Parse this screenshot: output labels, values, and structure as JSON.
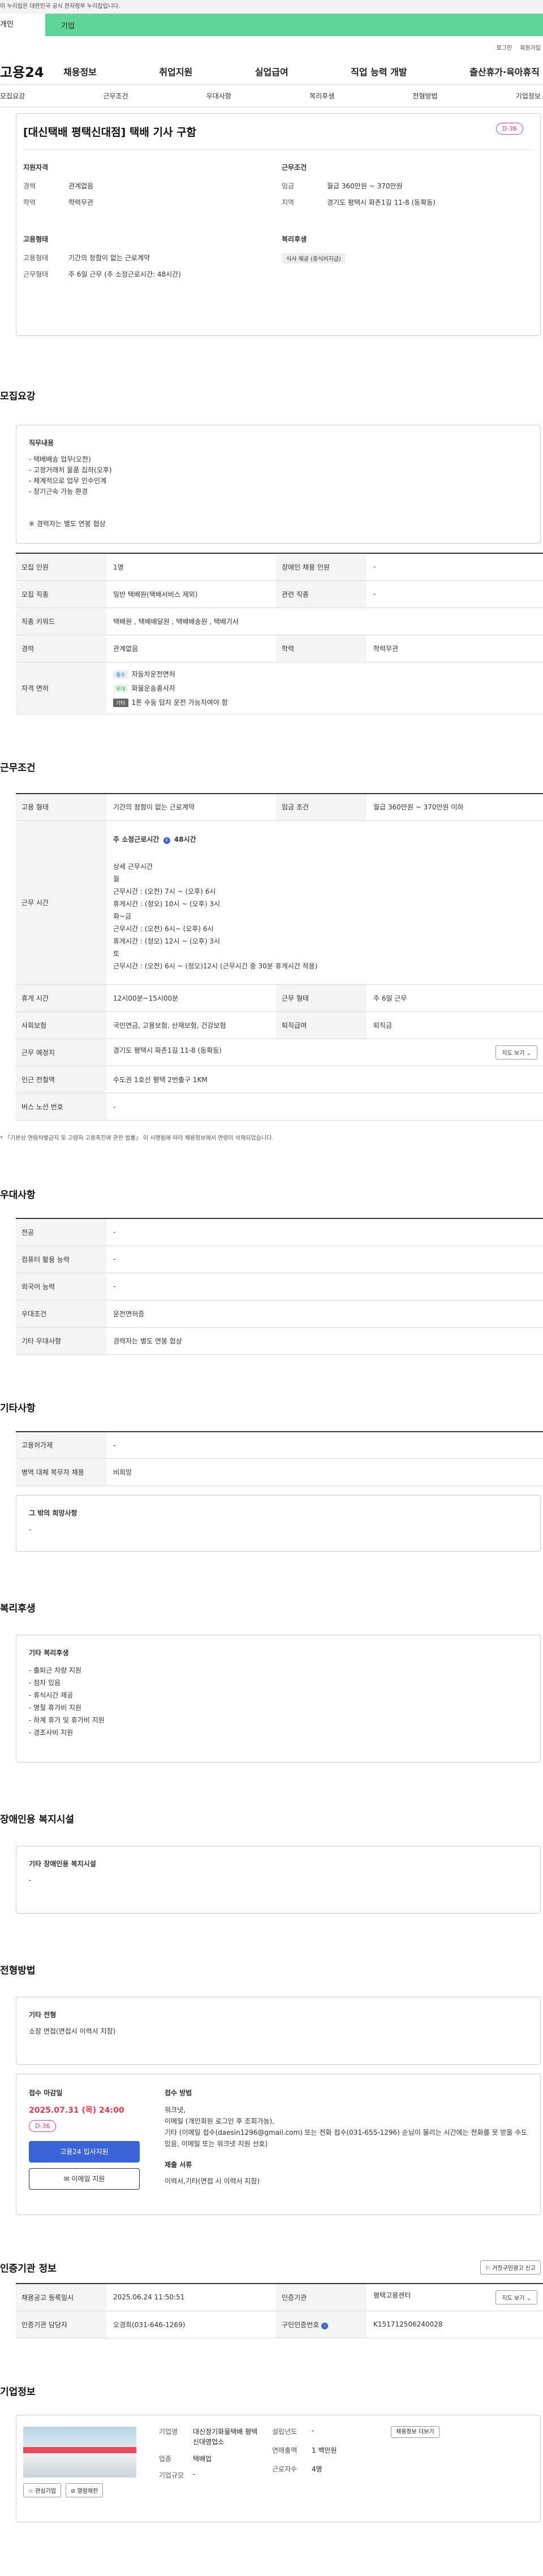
{
  "govbar": {
    "text": "이 누리집은 대한민국 공식 전자정부 누리집입니다."
  },
  "tabs": {
    "personal": "개인",
    "company": "기업"
  },
  "util": {
    "login": "로그인",
    "signup": "회원가입"
  },
  "header": {
    "logo": "고용24",
    "gnb": [
      "채용정보",
      "취업지원",
      "실업급여",
      "직업 능력 개발",
      "출산휴가·육아휴직"
    ]
  },
  "subnav": [
    "모집요강",
    "근무조건",
    "우대사항",
    "복리후생",
    "전형방법",
    "기업정보"
  ],
  "summary": {
    "title": "[대신택배 평택신대점] 택배 기사 구함",
    "dday": "D-36",
    "qual_head": "지원자격",
    "qual": [
      {
        "k": "경력",
        "v": "관계없음"
      },
      {
        "k": "학력",
        "v": "학력무관"
      }
    ],
    "work_head": "근무조건",
    "work": [
      {
        "k": "임금",
        "v": "월급 360만원 ~ 370만원"
      },
      {
        "k": "지역",
        "v": "경기도 평택시 화촌1길 11-8 (동확동)"
      }
    ],
    "emp_head": "고용형태",
    "emp": [
      {
        "k": "고용형태",
        "v": "기간의 정함이 없는 근로계약"
      },
      {
        "k": "근무형태",
        "v": "주 6일 근무 (주 소정근로시간: 48시간)"
      }
    ],
    "welfare_head": "복리후생",
    "welfare_tag": "식사 제공 (중식비지급)"
  },
  "recruit": {
    "heading": "모집요강",
    "job_title": "직무내용",
    "job_text": "- 택배배송 업무(오전)\n- 고정거래처 물품 집하(오후)\n- 체계적으로 업무 인수인계\n- 장기근속 가능 환경\n\n\n※ 경력자는 별도 연봉 협상",
    "rows": [
      {
        "k1": "모집 인원",
        "v1": "1명",
        "k2": "장애인 채용 인원",
        "v2": "-"
      },
      {
        "k1": "모집 직종",
        "v1": "일반 택배원(택배서비스 제외)",
        "k2": "관련 직종",
        "v2": "-"
      },
      {
        "k1": "직종 키워드",
        "v1": "택배원 , 택배배달원 , 택배배송원 , 택배기사"
      },
      {
        "k1": "경력",
        "v1": "관계없음",
        "k2": "학력",
        "v2": "학력무관"
      }
    ],
    "license_label": "자격 면허",
    "licenses": [
      {
        "tag": "필수",
        "text": "자동차운전면허"
      },
      {
        "tag": "우대",
        "text": "화물운송종사자"
      },
      {
        "tag": "기타",
        "text": "1톤 수동 탑차 운전 가능자여야 함"
      }
    ]
  },
  "work": {
    "heading": "근무조건",
    "emp_type_k": "고용 형태",
    "emp_type_v": "기간의 정함이 없는 근로계약",
    "wage_k": "임금 조건",
    "wage_v": "월급 360만원 ~ 370만원 이하",
    "hours_k": "근무 시간",
    "hours_main": "주 소정근로시간",
    "hours_main_v": "48시간",
    "hours_detail": "상세 근무시간\n월\n근무시간 : (오전) 7시 ~ (오후) 6시\n휴게시간 : (정오) 10시 ~ (오후) 3시\n화~금\n근무시간 : (오전) 6시~ (오후) 6시\n휴게시간 : (정오) 12시 ~ (오후) 3시\n토\n근무시간 : (오전) 6시 ~ (정오)12시 (근무시간 중 30분 휴게시간 적용)",
    "break_k": "휴게 시간",
    "break_v": "12시00분~15시00분",
    "shift_k": "근무 형태",
    "shift_v": "주 6일 근무",
    "ins_k": "사회보험",
    "ins_v": "국민연금, 고용보험, 산재보험, 건강보험",
    "ret_k": "퇴직급여",
    "ret_v": "퇴직금",
    "place_k": "근무 예정지",
    "place_v": "경기도 평택시 화촌1길 11-8 (동확동)",
    "map_btn": "지도 보기 ⌄",
    "subway_k": "인근 전철역",
    "subway_v": "수도권 1호선 평택 2번출구 1KM",
    "bus_k": "버스 노선 번호",
    "bus_v": "-",
    "note": "* 「기본상 연령차별금지 및 고령자 고용촉진에 관한 법률」 이 시행됨에 따라 채용정보에서 연령이 삭제되었습니다."
  },
  "pref": {
    "heading": "우대사항",
    "rows": [
      {
        "k": "전공",
        "v": "-"
      },
      {
        "k": "컴퓨터 활용 능력",
        "v": "-"
      },
      {
        "k": "외국어 능력",
        "v": "-"
      },
      {
        "k": "우대조건",
        "v": "운전면허증"
      },
      {
        "k": "기타 우대사항",
        "v": "경력자는 별도 연봉 협상"
      }
    ]
  },
  "etc": {
    "heading": "기타사항",
    "rows": [
      {
        "k": "고용허가제",
        "v": "-"
      },
      {
        "k": "병역 대체 복무자 채용",
        "v": "비희망"
      }
    ],
    "other_title": "그 밖의 희망사항",
    "other_text": "-"
  },
  "welfare": {
    "heading": "복리후생",
    "title": "기타 복리후생",
    "text": "- 출퇴근 차량 지원\n- 점차 있음\n- 휴식시간 제공\n- 명절 휴가비 지원\n- 하계 휴가 및 휴가비 지원\n- 경조사비 지원"
  },
  "disabled": {
    "heading": "장애인용 복지시설",
    "title": "기타 장애인용 복지시설",
    "text": "-"
  },
  "selection": {
    "heading": "전형방법",
    "title": "기타 전형",
    "text": "소장 면접(면접시 이력서 지참)",
    "deadline_label": "접수 마감일",
    "deadline": "2025.07.31 (목) 24:00",
    "dday": "D-36",
    "apply_btn": "고용24 입사지원",
    "email_btn": "✉ 이메일 지원",
    "method_label": "접수 방법",
    "method_text": "워크넷,\n이메일 (개인회원 로그인 후 조회가능),\n기타 (이메일 접수(daesin1296@gmail.com) 또는 전화 접수(031-655-1296) 순님이 몰리는 시간에는 전화를 못 받을 수도 있음, 이메일 또는 워크넷 지원 선호)",
    "docs_label": "제출 서류",
    "docs_text": "이력서,기타(면접 시 이력서 지참)"
  },
  "cert": {
    "heading": "인증기관 정보",
    "report_btn": "⚐ 거짓구인광고 신고",
    "rows": [
      {
        "k1": "채용공고 등록일시",
        "v1": "2025.06.24 11:50:51",
        "k2": "인증기관",
        "v2": "평택고용센터"
      },
      {
        "k1": "인증기관 담당자",
        "v1": "오경희(031-646-1269)",
        "k2": "구인인증번호",
        "v2": "K151712506240028"
      }
    ],
    "map_btn": "지도 보기 ⌄"
  },
  "company": {
    "heading": "기업정보",
    "fav_btn": "☆ 관심기업",
    "hide_btn": "⊘ 열람제한",
    "info": [
      {
        "k": "기업명",
        "v": "대신정기화물택배 평택신대영업소"
      },
      {
        "k": "업종",
        "v": "택배업"
      },
      {
        "k": "기업규모",
        "v": "-"
      }
    ],
    "info2": [
      {
        "k": "설립년도",
        "v": "-"
      },
      {
        "k": "연매출액",
        "v": "1 백만원"
      },
      {
        "k": "근로자수",
        "v": "4명"
      }
    ],
    "jobs_btn": "채용정보 더보기"
  },
  "colors": {
    "green": "#5fd39a",
    "primary": "#3b64d8",
    "red": "#e23c4a",
    "pink": "#e23c6b"
  }
}
